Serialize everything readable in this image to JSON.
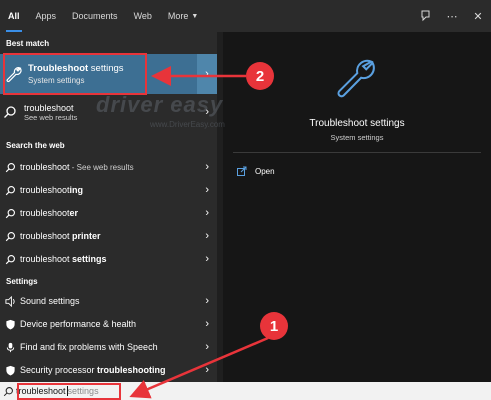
{
  "tabs": [
    "All",
    "Apps",
    "Documents",
    "Web",
    "More"
  ],
  "top_icons": [
    "feedback-icon",
    "more-options-icon",
    "close-icon"
  ],
  "sections": {
    "best_match": "Best match",
    "search_web": "Search the web",
    "settings": "Settings"
  },
  "best_match": {
    "title_bold": "Troubleshoot",
    "title_rest": " settings",
    "subtitle": "System settings"
  },
  "web_suggestion": {
    "label": "troubleshoot",
    "subtitle": "See web results"
  },
  "web_results": [
    {
      "prefix": "troubleshoot",
      "bold": "",
      "hint": " - See web results"
    },
    {
      "prefix": "troubleshoot",
      "bold": "ing",
      "hint": ""
    },
    {
      "prefix": "troubleshoot",
      "bold": "er",
      "hint": ""
    },
    {
      "prefix": "troubleshoot ",
      "bold": "printer",
      "hint": ""
    },
    {
      "prefix": "troubleshoot ",
      "bold": "settings",
      "hint": ""
    }
  ],
  "settings_results": [
    {
      "label": "Sound settings",
      "bold": ""
    },
    {
      "label": "Device performance & health",
      "bold": ""
    },
    {
      "label": "Find and fix problems with Speech",
      "bold": ""
    },
    {
      "label": "Security processor ",
      "bold": "troubleshooting"
    }
  ],
  "preview": {
    "title": "Troubleshoot settings",
    "subtitle": "System settings",
    "open_label": "Open"
  },
  "search": {
    "query": "troubleshoot",
    "ghost": "settings"
  },
  "annotations": {
    "badge1": "1",
    "badge2": "2"
  },
  "watermark": "driver easy",
  "watermark_url": "www.DriverEasy.com",
  "colors": {
    "highlight": "#3d6f93",
    "accent_underline": "#3a8ee6",
    "annotation_red": "#e8343a"
  }
}
